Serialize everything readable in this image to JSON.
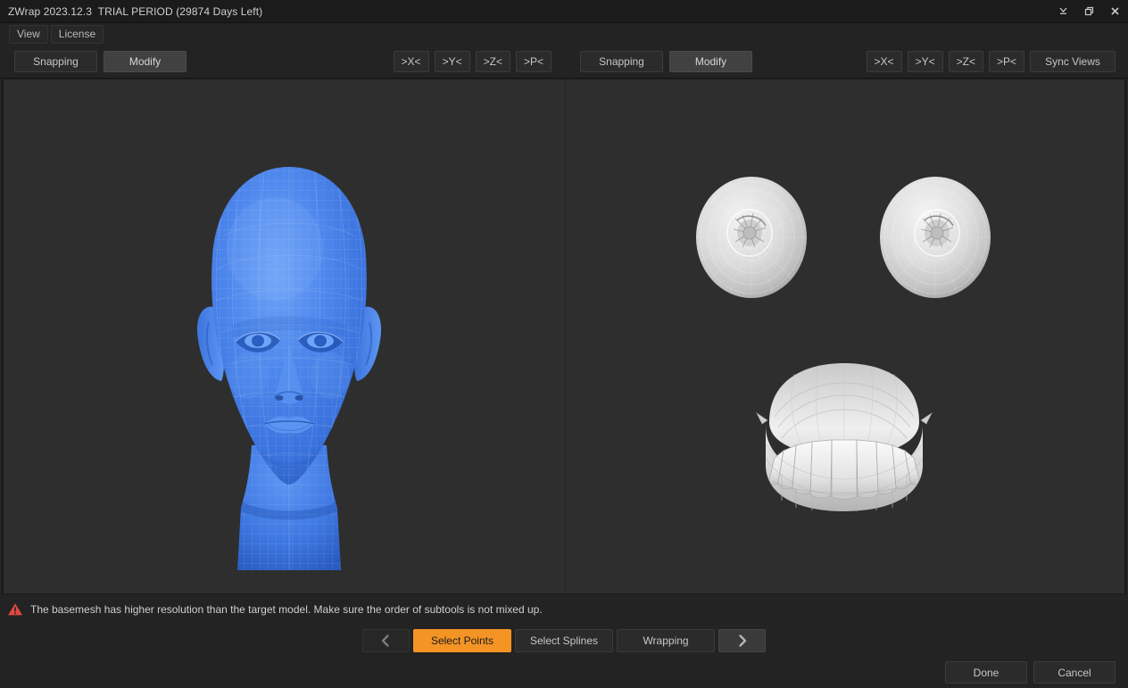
{
  "window": {
    "title": "ZWrap 2023.12.3  TRIAL PERIOD (29874 Days Left)",
    "controls": [
      {
        "name": "minimize",
        "glyph": "minimize-icon"
      },
      {
        "name": "restore",
        "glyph": "restore-icon"
      },
      {
        "name": "close",
        "glyph": "close-icon"
      }
    ]
  },
  "menubar": {
    "items": [
      {
        "label": "View"
      },
      {
        "label": "License"
      }
    ]
  },
  "toolbar": {
    "left": {
      "snapping_label": "Snapping",
      "modify_label": "Modify",
      "axis_buttons": [
        ">X<",
        ">Y<",
        ">Z<",
        ">P<"
      ]
    },
    "right": {
      "snapping_label": "Snapping",
      "modify_label": "Modify",
      "axis_buttons": [
        ">X<",
        ">Y<",
        ">Z<",
        ">P<"
      ],
      "sync_views_label": "Sync Views"
    }
  },
  "viewports": {
    "left": {
      "model": "head-basemesh",
      "color": "#3e7ce4"
    },
    "right": {
      "models": [
        "eyeball-left",
        "eyeball-right",
        "teeth-gums"
      ],
      "color": "#d9d9d9"
    }
  },
  "status": {
    "icon": "warning-icon",
    "warning_color": "#e2483f",
    "message": "The basemesh has higher resolution than the target model. Make sure the order of subtools is not mixed up."
  },
  "steps": {
    "prev_label": "prev-step",
    "next_label": "next-step",
    "items": [
      {
        "label": "Select Points",
        "active": true
      },
      {
        "label": "Select Splines",
        "active": false
      },
      {
        "label": "Wrapping",
        "active": false
      }
    ],
    "accent_color": "#f49425"
  },
  "footer": {
    "done_label": "Done",
    "cancel_label": "Cancel"
  }
}
